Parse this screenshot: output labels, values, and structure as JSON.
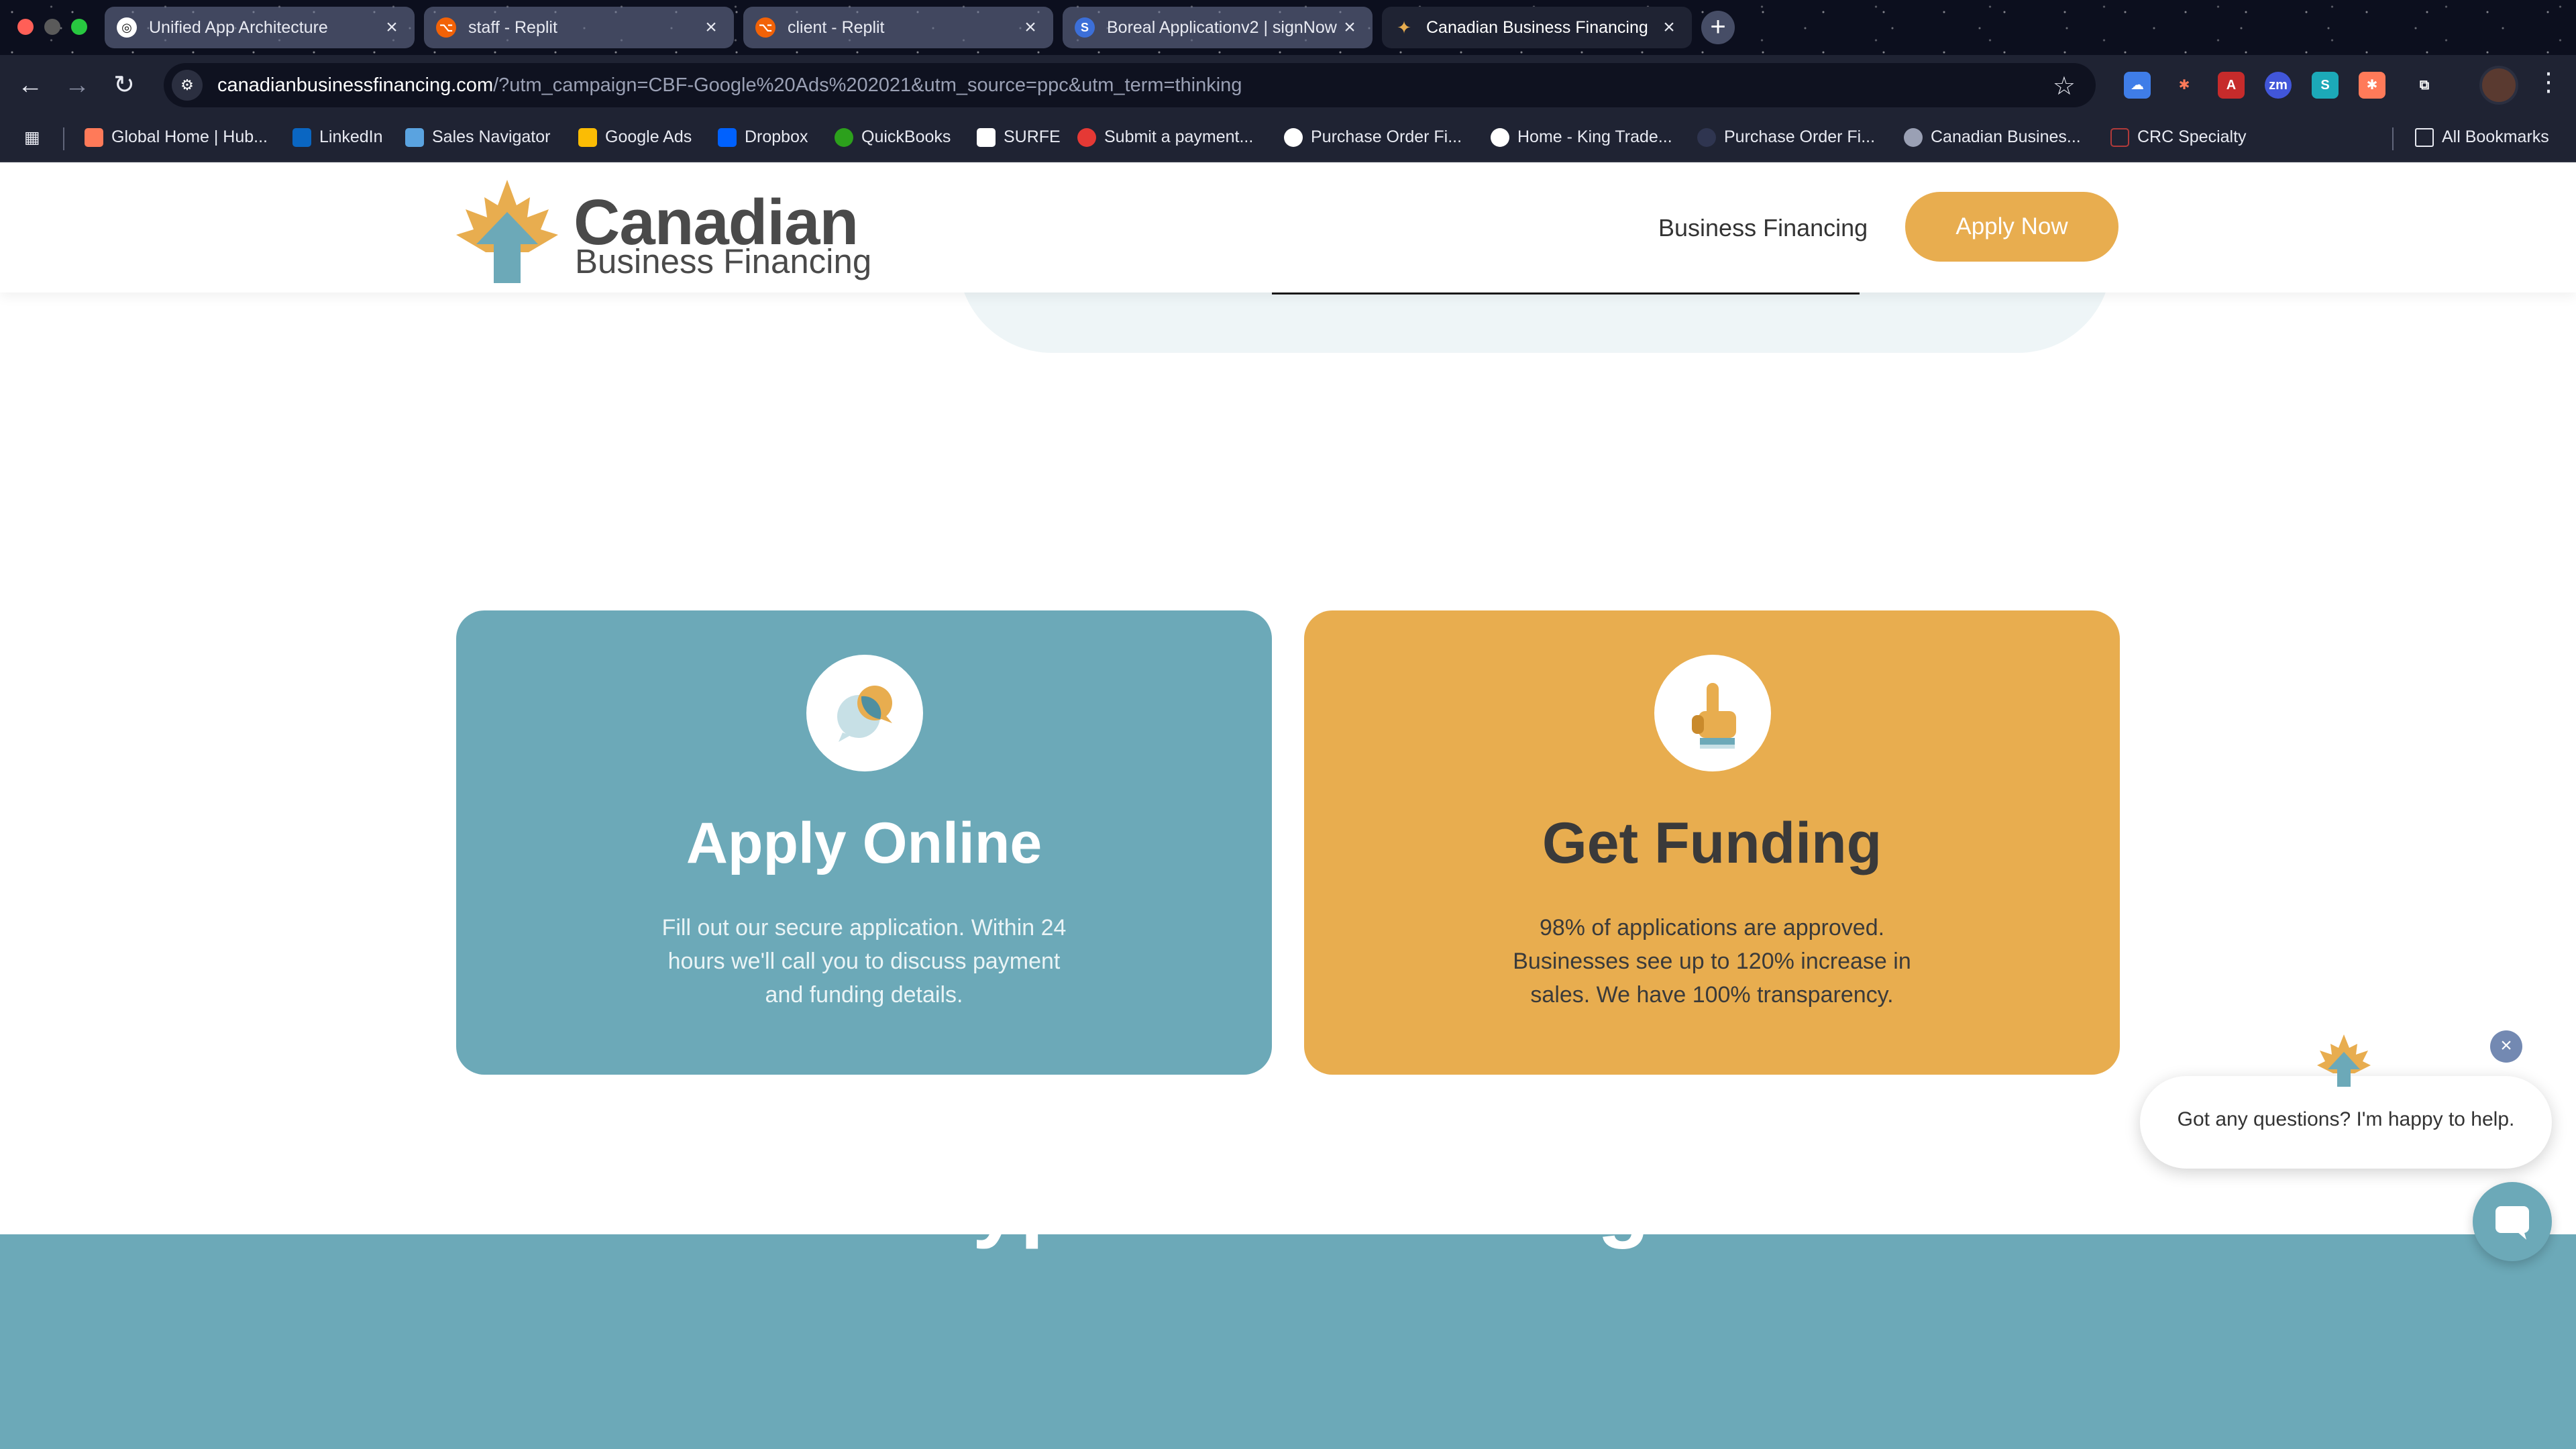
{
  "browser": {
    "tabs": [
      {
        "title": "Unified App Architecture",
        "icon": "openai-icon",
        "active": false
      },
      {
        "title": "staff - Replit",
        "icon": "replit-icon",
        "active": false
      },
      {
        "title": "client - Replit",
        "icon": "replit-icon",
        "active": false
      },
      {
        "title": "Boreal Applicationv2 | signNow",
        "icon": "signnow-icon",
        "active": false
      },
      {
        "title": "Canadian Business Financing",
        "icon": "maple-leaf-icon",
        "active": true
      }
    ],
    "url_host": "canadianbusinessfinancing.com",
    "url_rest": "/?utm_campaign=CBF-Google%20Ads%202021&utm_source=ppc&utm_term=thinking",
    "bookmarks": [
      "Global Home | Hub...",
      "LinkedIn",
      "Sales Navigator",
      "Google Ads",
      "Dropbox",
      "QuickBooks",
      "SURFE",
      "Submit a payment...",
      "Purchase Order Fi...",
      "Home - King Trade...",
      "Purchase Order Fi...",
      "Canadian Busines...",
      "CRC Specialty"
    ],
    "all_bookmarks": "All Bookmarks"
  },
  "site": {
    "logo_line1": "Canadian",
    "logo_line2": "Business Financing",
    "nav_link": "Business Financing",
    "apply_button": "Apply Now",
    "brand_colors": {
      "teal": "#6ca9b8",
      "gold": "#e8ad4f",
      "dark": "#3a3a3a"
    }
  },
  "cards": [
    {
      "title": "Apply Online",
      "text": "Fill out our secure application. Within 24 hours we'll call you to discuss payment and funding details.",
      "icon": "chat-bubbles-icon"
    },
    {
      "title": "Get Funding",
      "text": "98% of applications are approved. Businesses see up to 120% increase in sales. We have 100% transparency.",
      "icon": "pointing-hand-icon"
    }
  ],
  "types_section": {
    "title": "Types Of Funding"
  },
  "chat": {
    "prompt": "Got any questions? I'm happy to help.",
    "close": "×"
  }
}
